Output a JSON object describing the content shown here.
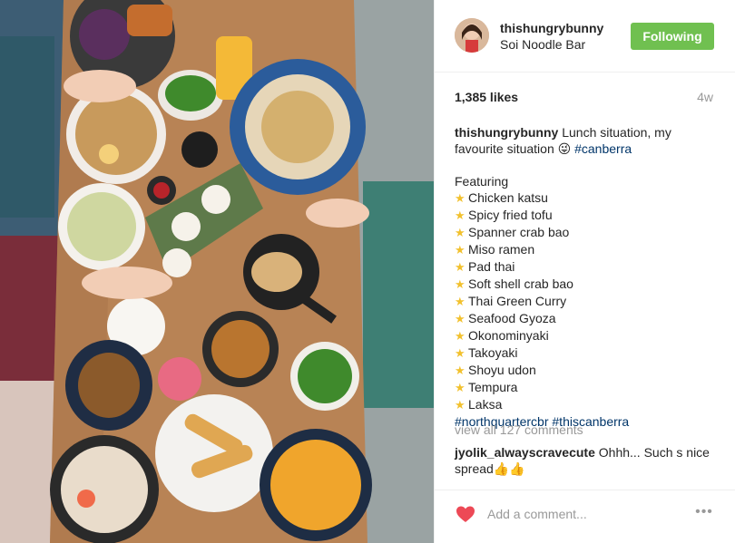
{
  "post": {
    "image_alt": "Overhead photo of a table full of Asian dishes",
    "username": "thishungrybunny",
    "location": "Soi Noodle Bar",
    "follow_label": "Following",
    "likes": "1,385 likes",
    "age": "4w",
    "caption": {
      "user": "thishungrybunny",
      "text": "Lunch situation, my favourite situation 😜",
      "hashtag": "#canberra",
      "featuring_label": "Featuring",
      "dishes": [
        "Chicken katsu",
        "Spicy fried tofu",
        "Spanner crab bao",
        "Miso ramen",
        "Pad thai",
        "Soft shell crab bao",
        "Thai Green Curry",
        "Seafood Gyoza",
        "Okonominyaki",
        "Takoyaki",
        "Shoyu udon",
        "Tempura",
        "Laksa"
      ],
      "tags": "#northquartercbr #thiscanberra"
    },
    "view_comments": "view all 127 comments",
    "comment": {
      "user": "jyolik_alwayscravecute",
      "text": "Ohhh... Such s nice spread👍👍"
    },
    "add_comment_placeholder": "Add a comment...",
    "more_label": "•••",
    "colors": {
      "follow_bg": "#70c050",
      "hashtag": "#003569",
      "heart": "#ed4956",
      "star": "#f2c12e"
    },
    "icons": [
      "heart-icon",
      "star-icon",
      "more-options-icon"
    ]
  }
}
